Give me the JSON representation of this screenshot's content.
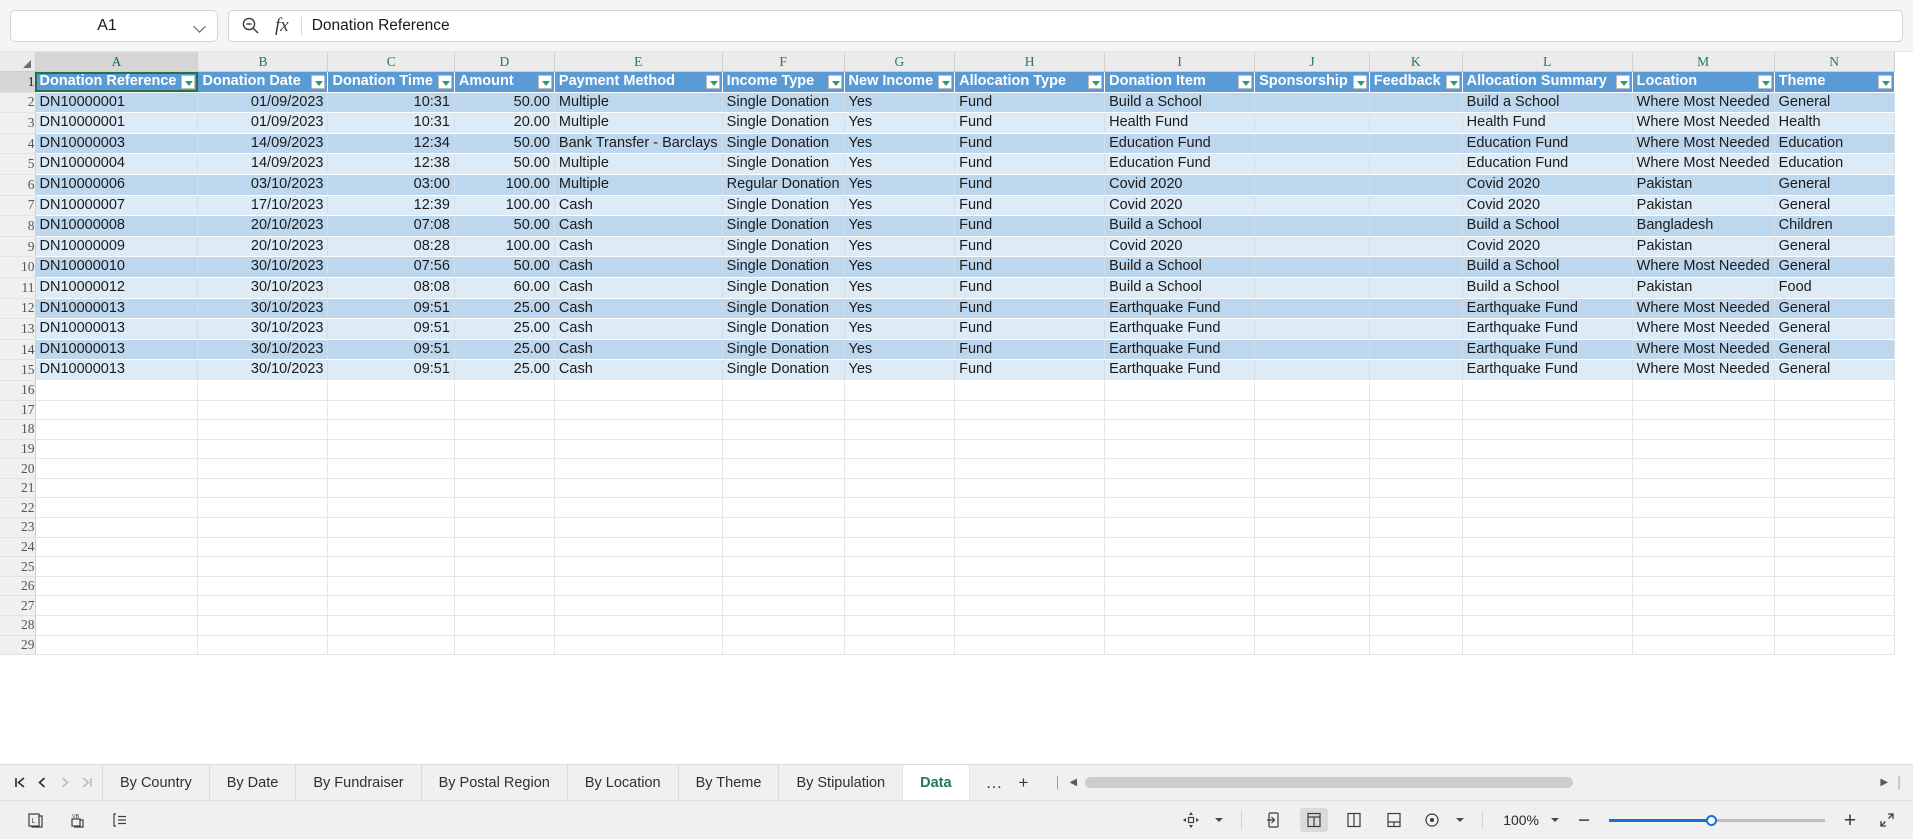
{
  "app": {
    "name_box_value": "A1",
    "formula_value": "Donation Reference",
    "search_icon": "zoom-search-icon",
    "fx_icon": "fx-icon"
  },
  "grid": {
    "column_letters": [
      "A",
      "B",
      "C",
      "D",
      "E",
      "F",
      "G",
      "H",
      "I",
      "J",
      "K",
      "L",
      "M",
      "N"
    ],
    "selected_column": "A",
    "row_numbers": [
      1,
      2,
      3,
      4,
      5,
      6,
      7,
      8,
      9,
      10,
      11,
      12,
      13,
      14,
      15,
      16,
      17,
      18,
      19,
      20,
      21,
      22,
      23,
      24,
      25,
      26,
      27,
      28,
      29
    ],
    "selected_row": 1,
    "headers": [
      "Donation Reference",
      "Donation Date",
      "Donation Time",
      "Amount",
      "Payment Method",
      "Income Type",
      "New Income",
      "Allocation Type",
      "Donation Item",
      "Sponsorship",
      "Feedback",
      "Allocation Summary",
      "Location",
      "Theme"
    ],
    "rows": [
      [
        "DN10000001",
        "01/09/2023",
        "10:31",
        "50.00",
        "Multiple",
        "Single Donation",
        "Yes",
        "Fund",
        "Build a School",
        "",
        "",
        "Build a School",
        "Where Most Needed",
        "General"
      ],
      [
        "DN10000001",
        "01/09/2023",
        "10:31",
        "20.00",
        "Multiple",
        "Single Donation",
        "Yes",
        "Fund",
        "Health Fund",
        "",
        "",
        "Health Fund",
        "Where Most Needed",
        "Health"
      ],
      [
        "DN10000003",
        "14/09/2023",
        "12:34",
        "50.00",
        "Bank Transfer - Barclays",
        "Single Donation",
        "Yes",
        "Fund",
        "Education Fund",
        "",
        "",
        "Education Fund",
        "Where Most Needed",
        "Education"
      ],
      [
        "DN10000004",
        "14/09/2023",
        "12:38",
        "50.00",
        "Multiple",
        "Single Donation",
        "Yes",
        "Fund",
        "Education Fund",
        "",
        "",
        "Education Fund",
        "Where Most Needed",
        "Education"
      ],
      [
        "DN10000006",
        "03/10/2023",
        "03:00",
        "100.00",
        "Multiple",
        "Regular Donation",
        "Yes",
        "Fund",
        "Covid 2020",
        "",
        "",
        "Covid 2020",
        "Pakistan",
        "General"
      ],
      [
        "DN10000007",
        "17/10/2023",
        "12:39",
        "100.00",
        "Cash",
        "Single Donation",
        "Yes",
        "Fund",
        "Covid 2020",
        "",
        "",
        "Covid 2020",
        "Pakistan",
        "General"
      ],
      [
        "DN10000008",
        "20/10/2023",
        "07:08",
        "50.00",
        "Cash",
        "Single Donation",
        "Yes",
        "Fund",
        "Build a School",
        "",
        "",
        "Build a School",
        "Bangladesh",
        "Children"
      ],
      [
        "DN10000009",
        "20/10/2023",
        "08:28",
        "100.00",
        "Cash",
        "Single Donation",
        "Yes",
        "Fund",
        "Covid 2020",
        "",
        "",
        "Covid 2020",
        "Pakistan",
        "General"
      ],
      [
        "DN10000010",
        "30/10/2023",
        "07:56",
        "50.00",
        "Cash",
        "Single Donation",
        "Yes",
        "Fund",
        "Build a School",
        "",
        "",
        "Build a School",
        "Where Most Needed",
        "General"
      ],
      [
        "DN10000012",
        "30/10/2023",
        "08:08",
        "60.00",
        "Cash",
        "Single Donation",
        "Yes",
        "Fund",
        "Build a School",
        "",
        "",
        "Build a School",
        "Pakistan",
        "Food"
      ],
      [
        "DN10000013",
        "30/10/2023",
        "09:51",
        "25.00",
        "Cash",
        "Single Donation",
        "Yes",
        "Fund",
        "Earthquake Fund",
        "",
        "",
        "Earthquake Fund",
        "Where Most Needed",
        "General"
      ],
      [
        "DN10000013",
        "30/10/2023",
        "09:51",
        "25.00",
        "Cash",
        "Single Donation",
        "Yes",
        "Fund",
        "Earthquake Fund",
        "",
        "",
        "Earthquake Fund",
        "Where Most Needed",
        "General"
      ],
      [
        "DN10000013",
        "30/10/2023",
        "09:51",
        "25.00",
        "Cash",
        "Single Donation",
        "Yes",
        "Fund",
        "Earthquake Fund",
        "",
        "",
        "Earthquake Fund",
        "Where Most Needed",
        "General"
      ],
      [
        "DN10000013",
        "30/10/2023",
        "09:51",
        "25.00",
        "Cash",
        "Single Donation",
        "Yes",
        "Fund",
        "Earthquake Fund",
        "",
        "",
        "Earthquake Fund",
        "Where Most Needed",
        "General"
      ]
    ]
  },
  "sheet_tabs": {
    "items": [
      {
        "label": "By Country",
        "active": false
      },
      {
        "label": "By Date",
        "active": false
      },
      {
        "label": "By Fundraiser",
        "active": false
      },
      {
        "label": "By Postal Region",
        "active": false
      },
      {
        "label": "By Location",
        "active": false
      },
      {
        "label": "By Theme",
        "active": false
      },
      {
        "label": "By Stipulation",
        "active": false
      },
      {
        "label": "Data",
        "active": true
      }
    ],
    "overflow_label": "…",
    "add_label": "+",
    "nav_first": "❘◀",
    "nav_prev": "‹",
    "nav_next": "›",
    "nav_last": "▶❘"
  },
  "status_bar": {
    "macro_icon": "record-macro-icon",
    "accessibility_icon": "accessibility-icon",
    "notes_icon": "display-settings-icon",
    "focus_icon": "focus-mode-icon",
    "view_normal_icon": "normal-view-icon",
    "view_pagelayout_icon": "page-layout-view-icon",
    "view_pagebreak_icon": "page-break-preview-icon",
    "display_settings_icon": "display-settings-icon",
    "zoom_level": "100%",
    "zoom_out_label": "−",
    "zoom_in_label": "+",
    "fullscreen_icon": "full-screen-icon"
  },
  "colors": {
    "header_blue": "#5b9bd5",
    "band_dark": "#bdd7ee",
    "band_light": "#ddebf7",
    "active_green": "#217346",
    "tab_active_text": "#1f7a5e",
    "slider_blue": "#1a6fd4"
  }
}
